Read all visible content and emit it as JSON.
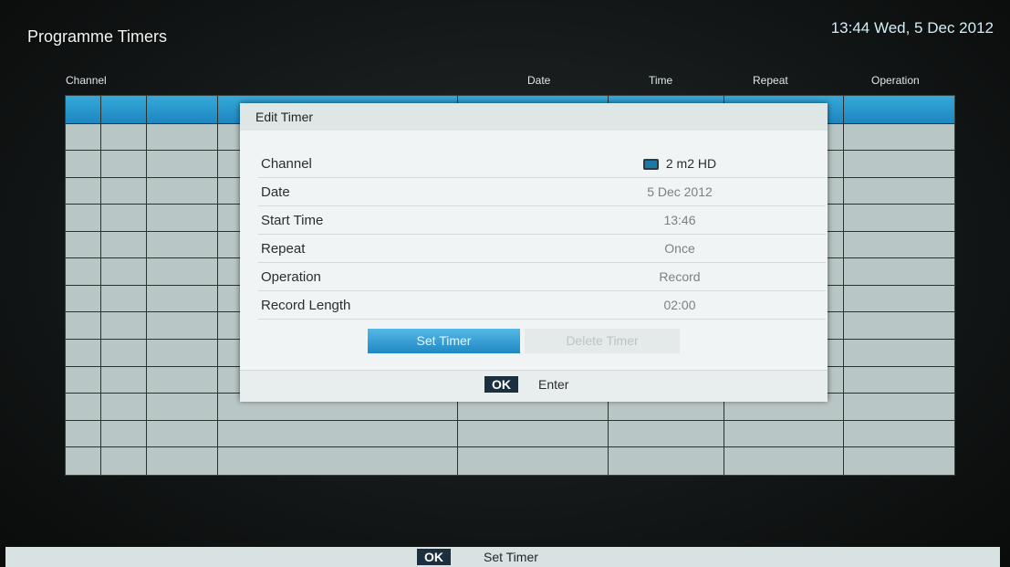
{
  "header": {
    "title": "Programme Timers",
    "datetime": "13:44 Wed, 5 Dec 2012"
  },
  "columns": {
    "channel": "Channel",
    "date": "Date",
    "time": "Time",
    "repeat": "Repeat",
    "operation": "Operation"
  },
  "dialog": {
    "title": "Edit Timer",
    "fields": [
      {
        "label": "Channel",
        "value": "2 m2 HD",
        "icon": "tv-icon"
      },
      {
        "label": "Date",
        "value": "5 Dec 2012"
      },
      {
        "label": "Start Time",
        "value": "13:46"
      },
      {
        "label": "Repeat",
        "value": "Once"
      },
      {
        "label": "Operation",
        "value": "Record"
      },
      {
        "label": "Record Length",
        "value": "02:00"
      }
    ],
    "buttons": {
      "set_timer": "Set Timer",
      "delete_timer": "Delete Timer"
    },
    "footer": {
      "key": "OK",
      "hint": "Enter"
    }
  },
  "bottom_bar": {
    "key": "OK",
    "hint": "Set Timer"
  },
  "colors": {
    "accent": "#1f88c3",
    "grid": "#b9c6c6",
    "dialog_bg": "#f0f4f4"
  }
}
